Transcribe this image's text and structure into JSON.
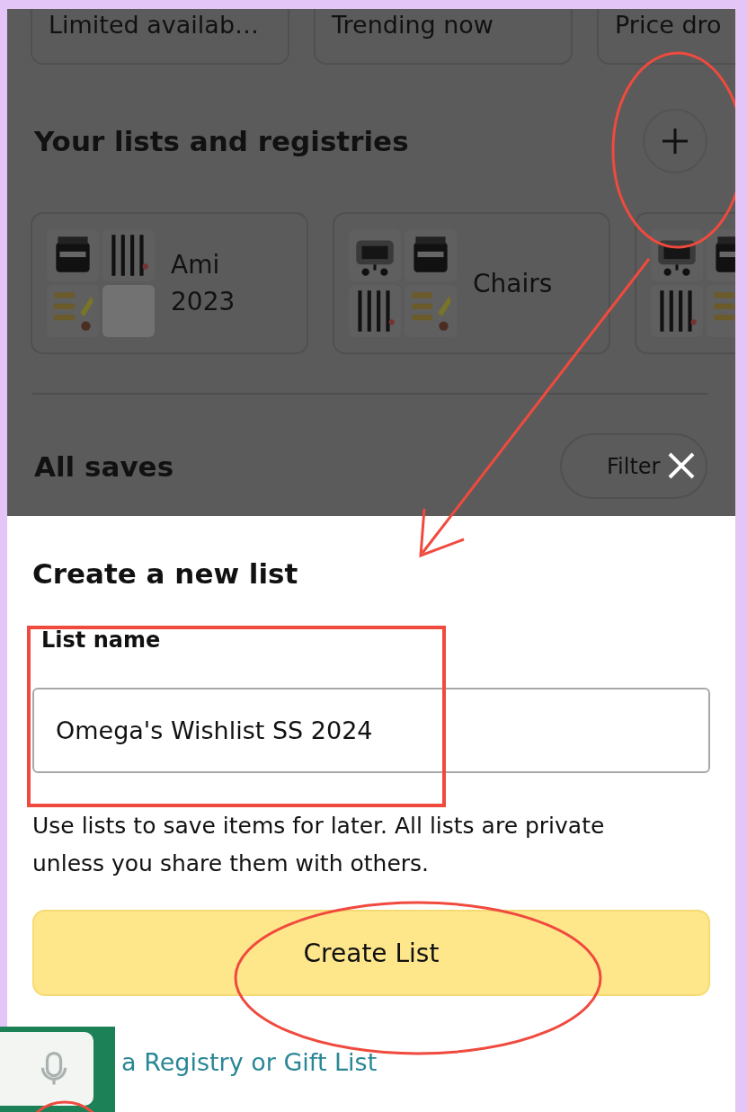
{
  "chips": [
    {
      "label": "Limited availab…"
    },
    {
      "label": "Trending now"
    },
    {
      "label": "Price dro"
    }
  ],
  "lists_section": {
    "title": "Your lists and registries",
    "lists": [
      {
        "name": "Ami 2023",
        "images": [
          {
            "kind": "picture"
          },
          {
            "kind": "picture"
          },
          {
            "kind": "picture"
          },
          {
            "kind": "empty"
          }
        ]
      },
      {
        "name": "Chairs",
        "images": [
          {
            "kind": "picture"
          },
          {
            "kind": "picture"
          },
          {
            "kind": "picture"
          },
          {
            "kind": "picture"
          }
        ]
      },
      {
        "images": [
          {
            "kind": "picture"
          },
          {
            "kind": "picture"
          },
          {
            "kind": "picture"
          },
          {
            "kind": "picture"
          }
        ]
      }
    ]
  },
  "all_saves": {
    "title": "All saves",
    "filter": "Filter"
  },
  "sheet": {
    "title": "Create a new list",
    "field": {
      "label": "List name",
      "value": "Omega's Wishlist SS 2024"
    },
    "help": "Use lists to save items for later. All lists are private unless you share them with others.",
    "button": "Create List",
    "link": "a Registry or Gift List"
  }
}
